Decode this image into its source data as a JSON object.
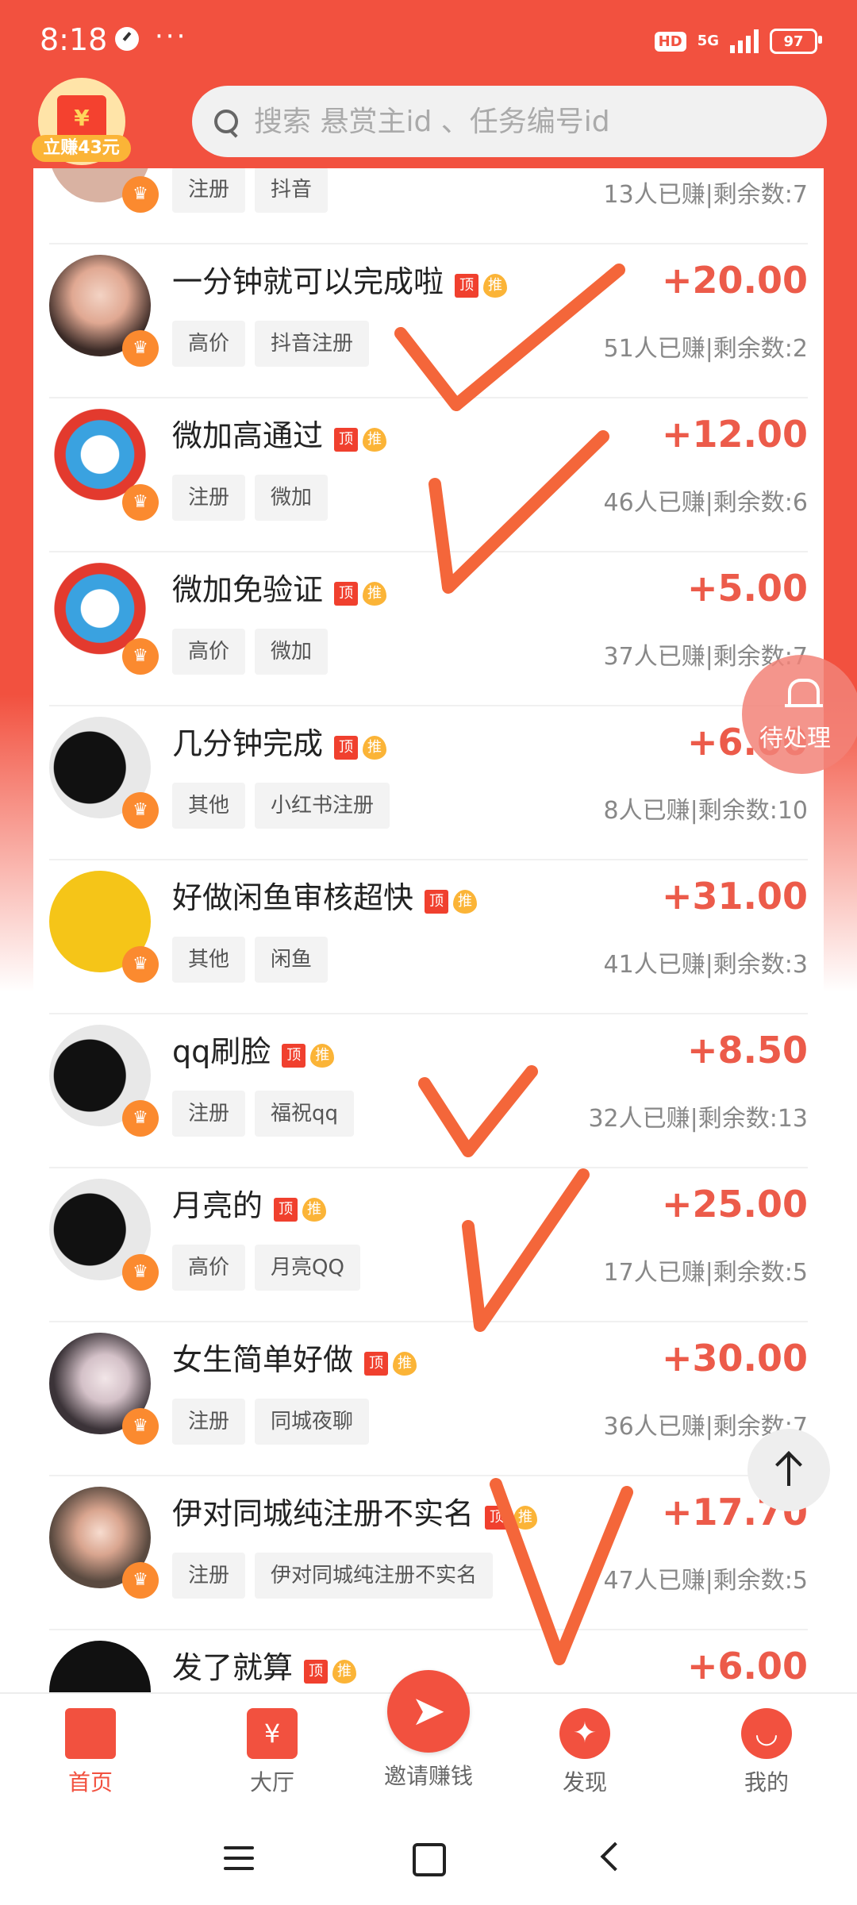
{
  "status_bar": {
    "time": "8:18",
    "dots": "···",
    "hd": "HD",
    "network": "5G",
    "battery": "97"
  },
  "header": {
    "reward_label": "立赚43元",
    "reward_symbol": "¥",
    "search_placeholder": "搜索 悬赏主id 、任务编号id"
  },
  "tasks": [
    {
      "title": "",
      "tags": [
        "注册",
        "抖音"
      ],
      "price": "",
      "stats": "13人已赚|剩余数:7"
    },
    {
      "title": "一分钟就可以完成啦",
      "tags": [
        "高价",
        "抖音注册"
      ],
      "price": "+20.00",
      "stats": "51人已赚|剩余数:2"
    },
    {
      "title": "微加高通过",
      "tags": [
        "注册",
        "微加"
      ],
      "price": "+12.00",
      "stats": "46人已赚|剩余数:6"
    },
    {
      "title": "微加免验证",
      "tags": [
        "高价",
        "微加"
      ],
      "price": "+5.00",
      "stats": "37人已赚|剩余数:7"
    },
    {
      "title": "几分钟完成",
      "tags": [
        "其他",
        "小红书注册"
      ],
      "price": "+6.00",
      "stats": "8人已赚|剩余数:10"
    },
    {
      "title": "好做闲鱼审核超快",
      "tags": [
        "其他",
        "闲鱼"
      ],
      "price": "+31.00",
      "stats": "41人已赚|剩余数:3"
    },
    {
      "title": "qq刷脸",
      "tags": [
        "注册",
        "福祝qq"
      ],
      "price": "+8.50",
      "stats": "32人已赚|剩余数:13"
    },
    {
      "title": "月亮的",
      "tags": [
        "高价",
        "月亮QQ"
      ],
      "price": "+25.00",
      "stats": "17人已赚|剩余数:5"
    },
    {
      "title": "女生简单好做",
      "tags": [
        "注册",
        "同城夜聊"
      ],
      "price": "+30.00",
      "stats": "36人已赚|剩余数:7"
    },
    {
      "title": "伊对同城纯注册不实名",
      "tags": [
        "注册",
        "伊对同城纯注册不实名"
      ],
      "price": "+17.70",
      "stats": "47人已赚|剩余数:5"
    },
    {
      "title": "发了就算",
      "tags": [],
      "price": "+6.00",
      "stats": ""
    }
  ],
  "badges": {
    "top": "顶",
    "recommend": "推"
  },
  "floating": {
    "pending_label": "待处理"
  },
  "tabbar": {
    "home": "首页",
    "hall": "大厅",
    "invite": "邀请赚钱",
    "discover": "发现",
    "mine": "我的"
  },
  "colors": {
    "brand": "#f2513f",
    "price": "#ec5b4a",
    "crown": "#fb8a2f",
    "check": "#f4663a"
  }
}
